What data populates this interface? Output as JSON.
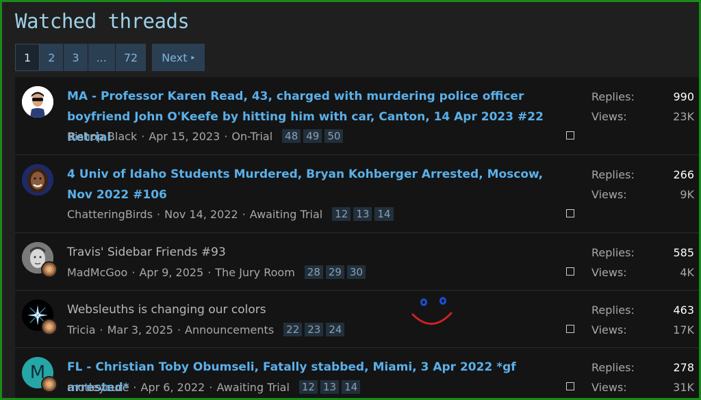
{
  "page_title": "Watched threads",
  "pager": {
    "pages": [
      "1",
      "2",
      "3",
      "...",
      "72"
    ],
    "current": "1",
    "next_label": "Next"
  },
  "stat_labels": {
    "replies": "Replies:",
    "views": "Views:"
  },
  "threads": [
    {
      "title": "MA - Professor Karen Read, 43, charged with murdering police officer boyfriend John O'Keefe by hitting him with car, Canton, 14 Apr 2023 #22 Retrial",
      "unread": true,
      "author": "Bishop Black",
      "date": "Apr 15, 2023",
      "forum": "On-Trial",
      "pages": [
        "48",
        "49",
        "50"
      ],
      "replies": "990",
      "views": "23K",
      "avatar": "sunglasses-avatar-icon"
    },
    {
      "title": "4 Univ of Idaho Students Murdered, Bryan Kohberger Arrested, Moscow, Nov 2022 #106",
      "unread": true,
      "author": "ChatteringBirds",
      "date": "Nov 14, 2022",
      "forum": "Awaiting Trial",
      "pages": [
        "12",
        "13",
        "14"
      ],
      "replies": "266",
      "views": "9K",
      "avatar": "portrait-avatar-icon"
    },
    {
      "title": "Travis' Sidebar Friends #93",
      "unread": false,
      "author": "MadMcGoo",
      "date": "Apr 9, 2025",
      "forum": "The Jury Room",
      "pages": [
        "28",
        "29",
        "30"
      ],
      "replies": "585",
      "views": "4K",
      "avatar": "bw-portrait-avatar-icon"
    },
    {
      "title": "Websleuths is changing our colors",
      "unread": false,
      "author": "Tricia",
      "date": "Mar 3, 2025",
      "forum": "Announcements",
      "pages": [
        "22",
        "23",
        "24"
      ],
      "replies": "463",
      "views": "17K",
      "avatar": "starburst-avatar-icon"
    },
    {
      "title": "FL - Christian Toby Obumseli, Fatally stabbed, Miami, 3 Apr 2022 *gf arrested*",
      "unread": true,
      "author": "motleycure",
      "date": "Apr 6, 2022",
      "forum": "Awaiting Trial",
      "pages": [
        "12",
        "13",
        "14"
      ],
      "replies": "278",
      "views": "31K",
      "avatar": "letter-m-avatar-icon",
      "avatar_letter": "M"
    }
  ],
  "colors": {
    "accent": "#5ab0ea",
    "frame": "#1a8a1a",
    "title": "#9fd0e8",
    "smiley_eyes": "#1a4fd8",
    "smiley_mouth": "#d42020"
  }
}
